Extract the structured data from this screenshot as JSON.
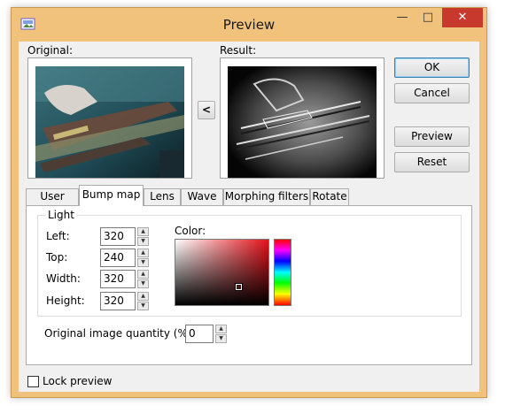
{
  "window": {
    "title": "Preview",
    "controls": {
      "minimize": "—",
      "maximize": "□",
      "close": "✕"
    }
  },
  "labels": {
    "original": "Original:",
    "result": "Result:"
  },
  "buttons": {
    "ok": "OK",
    "cancel": "Cancel",
    "preview": "Preview",
    "reset": "Reset",
    "copy_left": "<"
  },
  "tabs": [
    {
      "label": "User filter",
      "active": false
    },
    {
      "label": "Bump map",
      "active": true
    },
    {
      "label": "Lens",
      "active": false
    },
    {
      "label": "Wave",
      "active": false
    },
    {
      "label": "Morphing filters",
      "active": false
    },
    {
      "label": "Rotate",
      "active": false
    }
  ],
  "light": {
    "group_title": "Light",
    "fields": [
      {
        "label": "Left:",
        "value": "320"
      },
      {
        "label": "Top:",
        "value": "240"
      },
      {
        "label": "Width:",
        "value": "320"
      },
      {
        "label": "Height:",
        "value": "320"
      }
    ],
    "color_label": "Color:"
  },
  "original_quantity": {
    "label": "Original image quantity (%):",
    "value": "0"
  },
  "lock_preview": {
    "label": "Lock preview",
    "checked": false
  },
  "icons": {
    "spin_up": "▲",
    "spin_down": "▼"
  },
  "colors": {
    "title_bar": "#f0c27b",
    "close_button": "#c7392d",
    "selected_hue": "#e3121a"
  }
}
